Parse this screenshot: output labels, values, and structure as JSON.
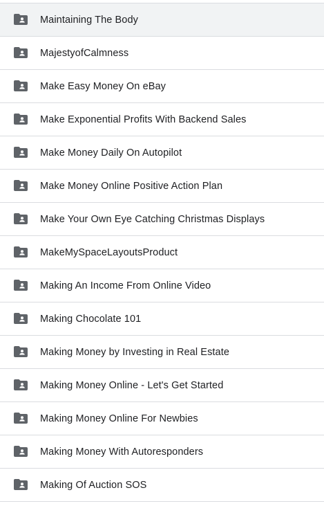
{
  "folders": [
    {
      "name": "Maintaining The Body",
      "icon": "shared-folder-icon",
      "selected": true
    },
    {
      "name": "MajestyofCalmness",
      "icon": "shared-folder-icon"
    },
    {
      "name": "Make Easy Money On eBay",
      "icon": "shared-folder-icon"
    },
    {
      "name": "Make Exponential Profits With Backend Sales",
      "icon": "shared-folder-icon"
    },
    {
      "name": "Make Money Daily On Autopilot",
      "icon": "shared-folder-icon"
    },
    {
      "name": "Make Money Online Positive Action Plan",
      "icon": "shared-folder-icon"
    },
    {
      "name": "Make Your Own Eye Catching Christmas Displays",
      "icon": "shared-folder-icon"
    },
    {
      "name": "MakeMySpaceLayoutsProduct",
      "icon": "shared-folder-icon"
    },
    {
      "name": "Making An Income From Online Video",
      "icon": "shared-folder-icon"
    },
    {
      "name": "Making Chocolate 101",
      "icon": "shared-folder-icon"
    },
    {
      "name": "Making Money by Investing in Real Estate",
      "icon": "shared-folder-icon"
    },
    {
      "name": "Making Money Online - Let's Get Started",
      "icon": "shared-folder-icon"
    },
    {
      "name": "Making Money Online For Newbies",
      "icon": "shared-folder-icon"
    },
    {
      "name": "Making Money With Autoresponders",
      "icon": "shared-folder-icon"
    },
    {
      "name": "Making Of Auction SOS",
      "icon": "shared-folder-icon"
    }
  ],
  "colors": {
    "icon": "#5f6368",
    "text": "#202124",
    "divider": "#dadce0",
    "selected_bg": "#f1f3f4"
  }
}
